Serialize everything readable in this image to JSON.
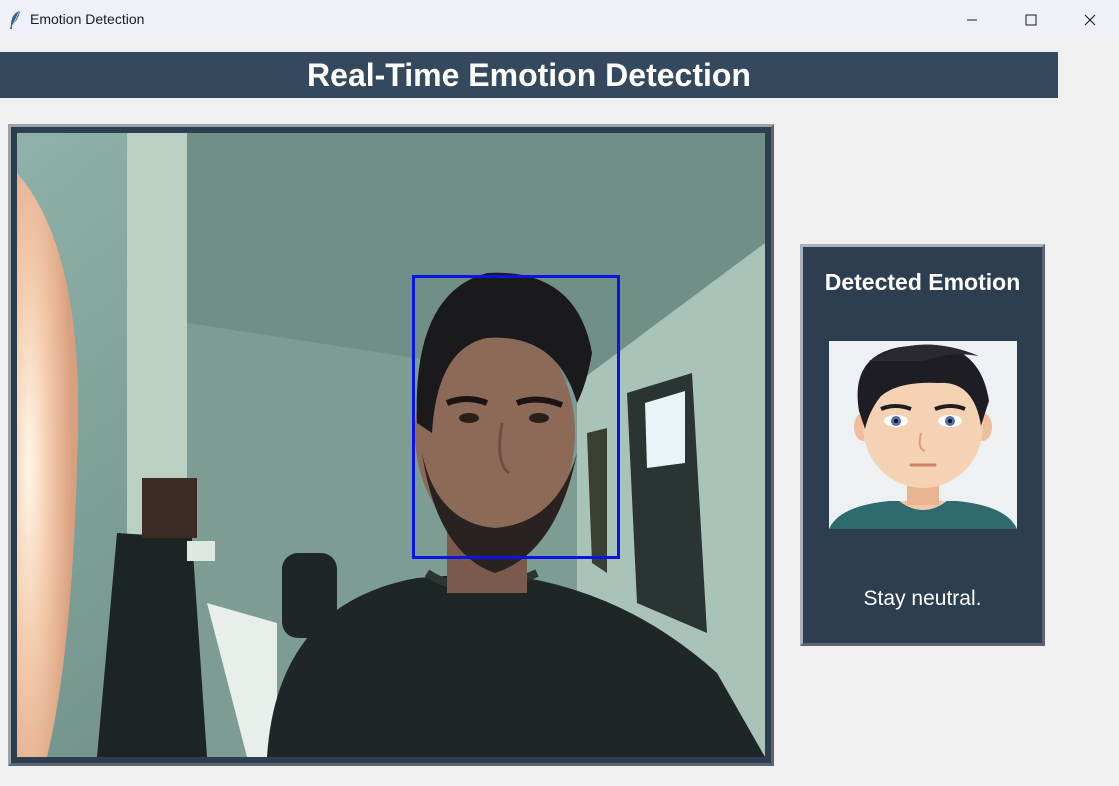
{
  "window": {
    "title": "Emotion Detection",
    "icon": "feather-icon",
    "controls": [
      "minimize-icon",
      "maximize-icon",
      "close-icon"
    ]
  },
  "header": {
    "title": "Real-Time Emotion Detection",
    "background": "#34495e"
  },
  "camera": {
    "face_box_color": "#0a14e6"
  },
  "emotion_panel": {
    "title": "Detected Emotion",
    "avatar": "neutral-avatar",
    "message": "Stay neutral.",
    "background": "#2c3e50"
  }
}
